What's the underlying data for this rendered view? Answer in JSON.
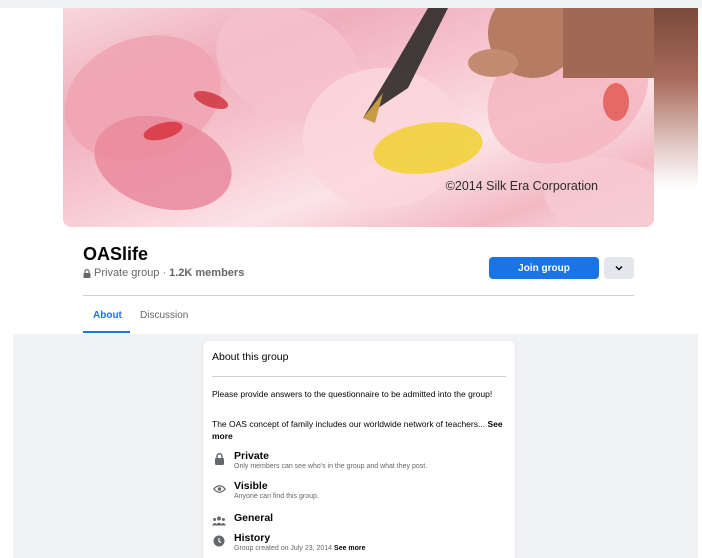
{
  "cover": {
    "watermark": "©2014 Silk Era Corporation"
  },
  "group": {
    "name": "OASlife",
    "privacy": "Private group",
    "separator": "·",
    "members": "1.2K members"
  },
  "actions": {
    "join_label": "Join group"
  },
  "tabs": [
    {
      "label": "About",
      "active": true
    },
    {
      "label": "Discussion",
      "active": false
    }
  ],
  "about": {
    "title": "About this group",
    "description_1": "Please provide answers to the questionnaire to be admitted into the group!",
    "description_2": "The OAS concept of family includes our worldwide network of teachers...",
    "see_more": "See more",
    "items": [
      {
        "icon": "lock-icon",
        "title": "Private",
        "subtitle": "Only members can see who's in the group and what they post."
      },
      {
        "icon": "eye-icon",
        "title": "Visible",
        "subtitle": "Anyone can find this group."
      },
      {
        "icon": "people-icon",
        "title": "General",
        "subtitle": ""
      },
      {
        "icon": "clock-icon",
        "title": "History",
        "subtitle": "Group created on July 23, 2014",
        "see_more": "See more"
      }
    ]
  },
  "colors": {
    "accent": "#1b74e4",
    "background": "#f0f2f5",
    "secondary_text": "#65676b"
  }
}
